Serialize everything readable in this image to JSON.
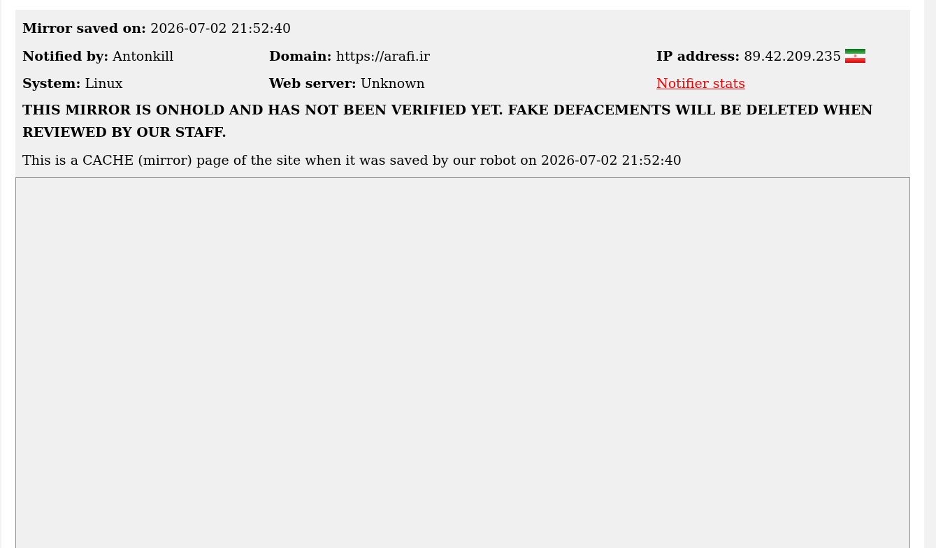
{
  "saved": {
    "label": "Mirror saved on:",
    "value": "2026-07-02 21:52:40"
  },
  "fields": [
    {
      "kind": "field",
      "label": "Notified by:",
      "value": "Antonkill"
    },
    {
      "kind": "field",
      "label": "Domain:",
      "value": "https://arafi.ir"
    },
    {
      "kind": "flagged",
      "label": "IP address:",
      "value": "89.42.209.235"
    },
    {
      "kind": "field",
      "label": "System:",
      "value": "Linux"
    },
    {
      "kind": "field",
      "label": "Web server:",
      "value": "Unknown"
    },
    {
      "kind": "link",
      "text": "Notifier stats"
    }
  ],
  "warning": "THIS MIRROR IS ONHOLD AND HAS NOT BEEN VERIFIED YET. FAKE DEFACEMENTS WILL BE DELETED WHEN REVIEWED BY OUR STAFF.",
  "cache_note": "This is a CACHE (mirror) page of the site when it was saved by our robot on 2026-07-02 21:52:40"
}
